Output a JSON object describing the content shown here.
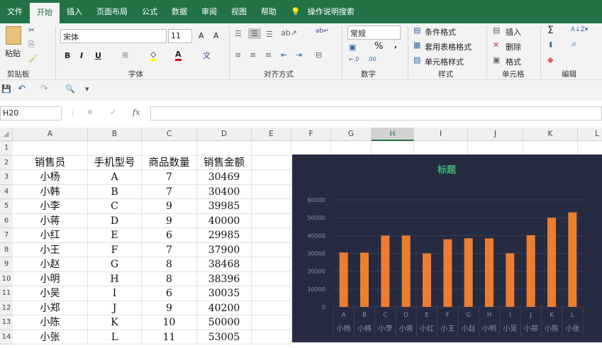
{
  "tabs": [
    "文件",
    "开始",
    "插入",
    "页面布局",
    "公式",
    "数据",
    "审阅",
    "视图",
    "帮助",
    "操作说明搜索"
  ],
  "ribbon": {
    "clipboard": {
      "paste": "粘贴",
      "label": "剪贴板"
    },
    "font": {
      "name": "宋体",
      "size": "11",
      "label": "字体",
      "bold": "B",
      "italic": "I",
      "underline": "U",
      "grow": "A",
      "shrink": "A",
      "color_a": "A"
    },
    "align": {
      "label": "对齐方式"
    },
    "number": {
      "format": "常规",
      "percent": "%",
      "comma": ",",
      "label": "数字"
    },
    "styles": {
      "cond": "条件格式",
      "table": "套用表格格式",
      "cell": "单元格样式",
      "label": "样式"
    },
    "cells": {
      "insert": "插入",
      "delete": "删除",
      "format": "格式",
      "label": "单元格"
    },
    "edit": {
      "sum": "Σ",
      "label": "编辑"
    }
  },
  "formula": {
    "namebox": "H20",
    "fx": "fx",
    "value": ""
  },
  "columns": [
    "A",
    "B",
    "C",
    "D",
    "E",
    "F",
    "G",
    "H",
    "I",
    "J",
    "K",
    "L"
  ],
  "selected_column": "H",
  "rows": [
    "1",
    "2",
    "3",
    "4",
    "5",
    "6",
    "7",
    "8",
    "9",
    "10",
    "11",
    "12",
    "13",
    "14"
  ],
  "table": {
    "headers": [
      "销售员",
      "手机型号",
      "商品数量",
      "销售金额"
    ],
    "data": [
      [
        "小杨",
        "A",
        "7",
        "30469"
      ],
      [
        "小韩",
        "B",
        "7",
        "30400"
      ],
      [
        "小李",
        "C",
        "9",
        "39985"
      ],
      [
        "小蒋",
        "D",
        "9",
        "40000"
      ],
      [
        "小红",
        "E",
        "6",
        "29985"
      ],
      [
        "小王",
        "F",
        "7",
        "37900"
      ],
      [
        "小赵",
        "G",
        "8",
        "38468"
      ],
      [
        "小明",
        "H",
        "8",
        "38396"
      ],
      [
        "小吴",
        "I",
        "6",
        "30035"
      ],
      [
        "小郑",
        "J",
        "9",
        "40200"
      ],
      [
        "小陈",
        "K",
        "10",
        "50000"
      ],
      [
        "小张",
        "L",
        "11",
        "53005"
      ]
    ]
  },
  "chart_data": {
    "type": "bar",
    "title": "标题",
    "categories": [
      "A",
      "B",
      "C",
      "D",
      "E",
      "F",
      "G",
      "H",
      "I",
      "J",
      "K",
      "L"
    ],
    "category_labels": [
      "小杨",
      "小韩",
      "小李",
      "小蒋",
      "小红",
      "小王",
      "小赵",
      "小明",
      "小吴",
      "小郑",
      "小陈",
      "小张"
    ],
    "values": [
      30469,
      30400,
      39985,
      40000,
      29985,
      37900,
      38468,
      38396,
      30035,
      40200,
      50000,
      53005
    ],
    "ylim": [
      0,
      60000
    ],
    "yticks": [
      "0",
      "10000",
      "20000",
      "30000",
      "40000",
      "50000",
      "60000"
    ],
    "bar_color": "#ed7d31",
    "background": "#272b42",
    "title_color": "#3cb371"
  }
}
